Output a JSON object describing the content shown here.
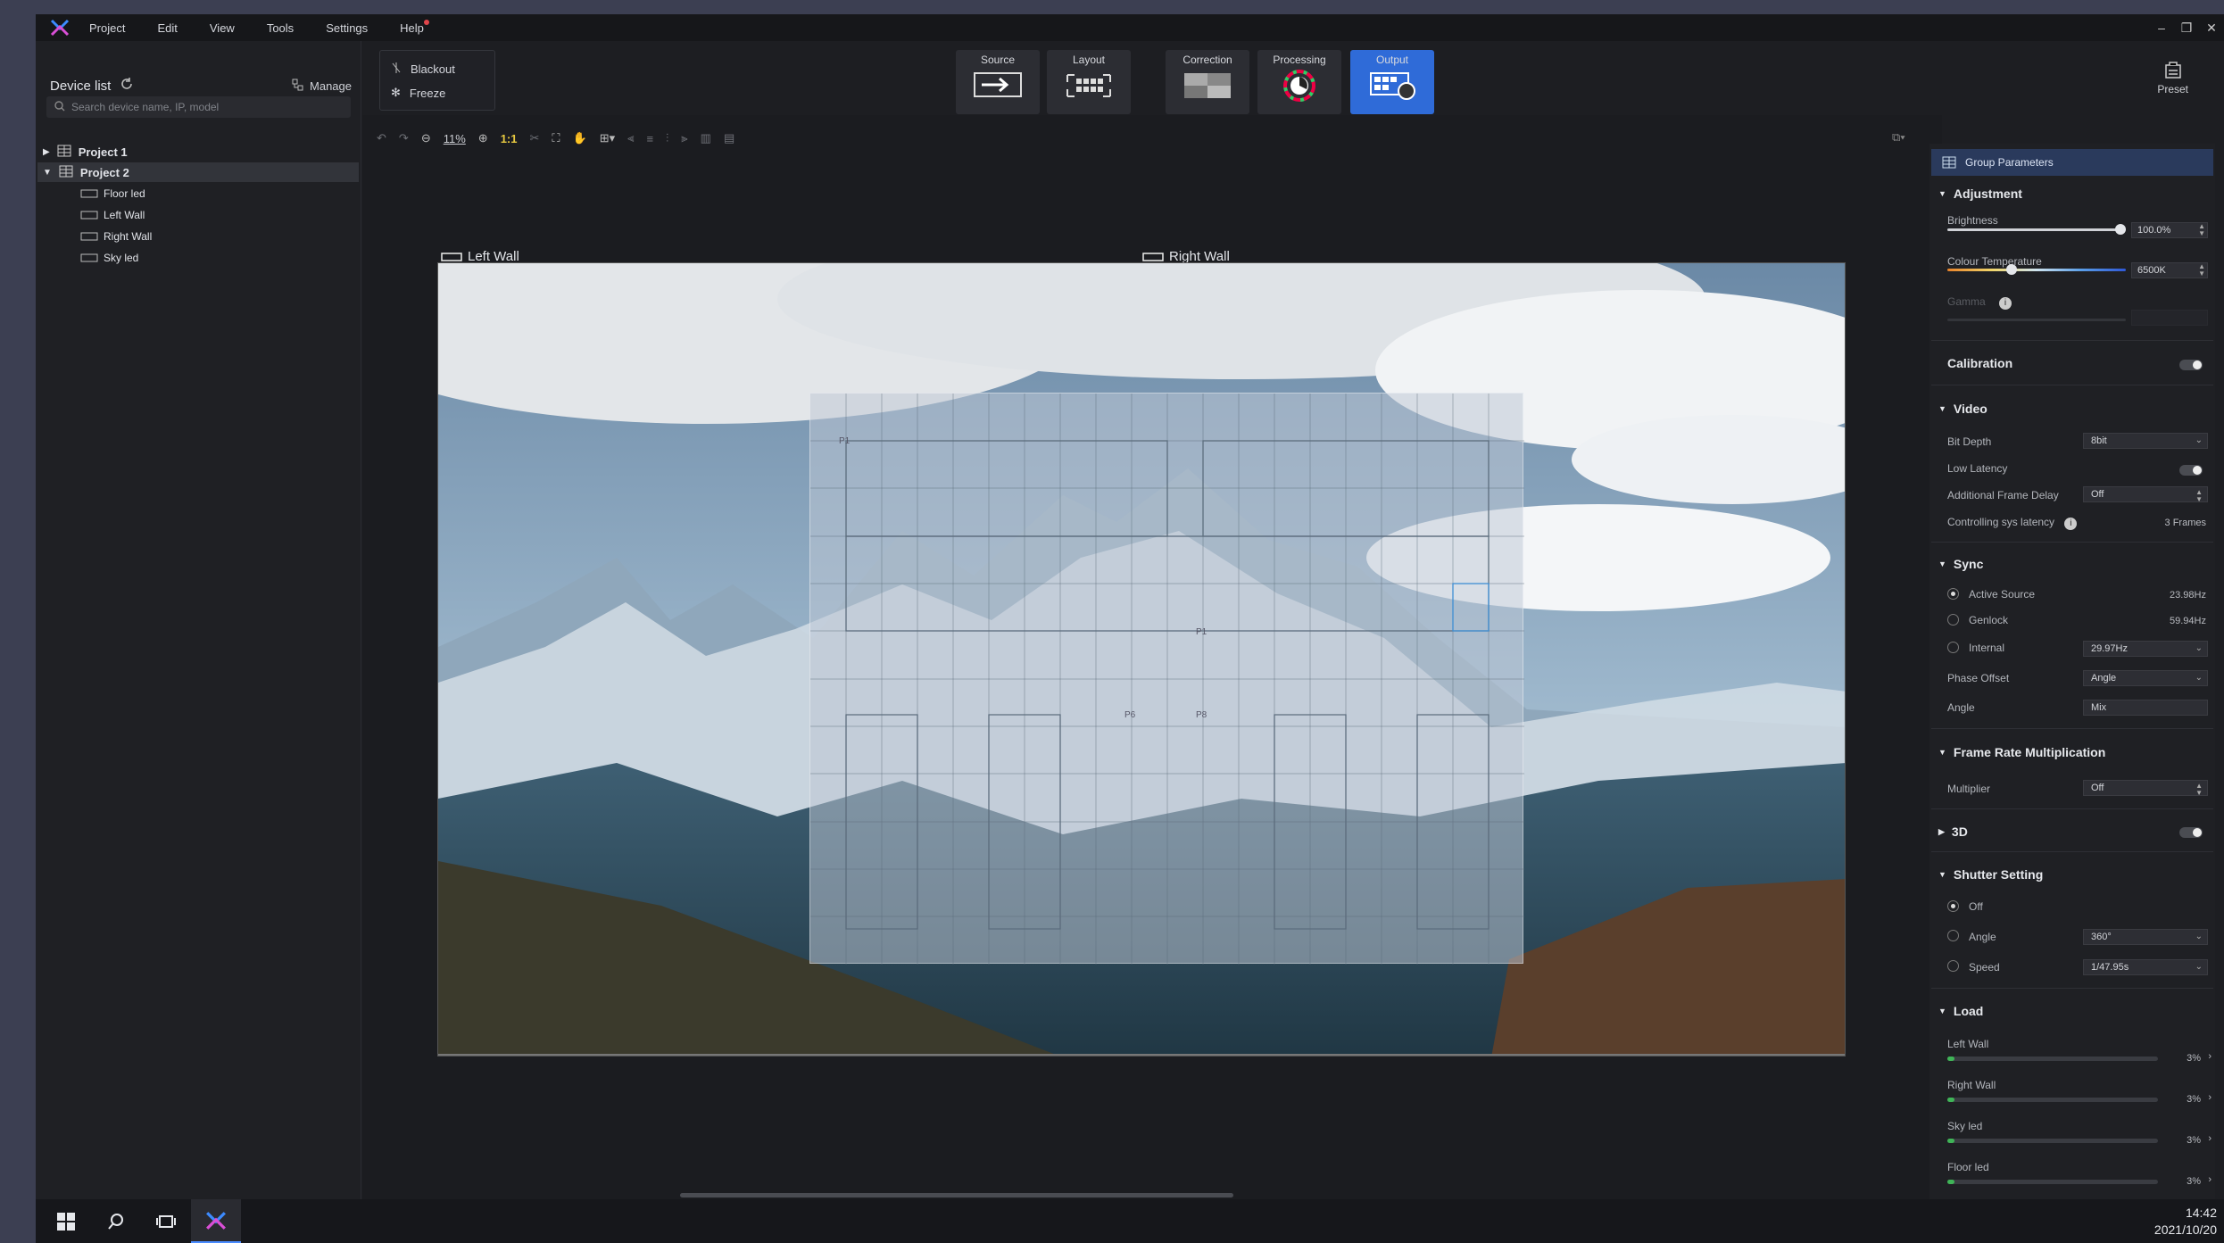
{
  "menu": [
    "Project",
    "Edit",
    "View",
    "Tools",
    "Settings",
    "Help"
  ],
  "device_list": {
    "title": "Device list",
    "manage": "Manage",
    "search_placeholder": "Search device name, IP, model",
    "projects": [
      {
        "label": "Project 1"
      },
      {
        "label": "Project 2"
      }
    ],
    "children": [
      "Floor led",
      "Left Wall",
      "Right Wall",
      "Sky led"
    ]
  },
  "quick": {
    "blackout": "Blackout",
    "freeze": "Freeze"
  },
  "modes": [
    {
      "label": "Source"
    },
    {
      "label": "Layout"
    },
    {
      "label": "Correction"
    },
    {
      "label": "Processing"
    },
    {
      "label": "Output"
    }
  ],
  "preset": "Preset",
  "toolbar": {
    "zoom": "11%",
    "one_to_one": "1:1"
  },
  "canvas": {
    "left_wall": "Left Wall",
    "right_wall": "Right Wall",
    "p1a": "P1",
    "p1b": "P1",
    "p6": "P6",
    "p8": "P8"
  },
  "panel": {
    "group_params": "Group Parameters",
    "adjustment": "Adjustment",
    "brightness": "Brightness",
    "brightness_val": "100.0%",
    "brightness_level": 1.0,
    "colour_temp": "Colour Temperature",
    "colour_temp_val": "6500K",
    "gamma": "Gamma",
    "calibration": "Calibration",
    "video": "Video",
    "bit_depth": "Bit Depth",
    "bit_depth_val": "8bit",
    "low_latency": "Low Latency",
    "frame_delay": "Additional Frame Delay",
    "frame_delay_val": "Off",
    "sys_latency": "Controlling sys latency",
    "sys_latency_val": "3 Frames",
    "sync": "Sync",
    "active_source": "Active Source",
    "active_source_val": "23.98Hz",
    "genlock": "Genlock",
    "genlock_val": "59.94Hz",
    "internal": "Internal",
    "internal_val": "29.97Hz",
    "phase_offset": "Phase Offset",
    "phase_offset_val": "Angle",
    "angle": "Angle",
    "angle_val": "Mix",
    "frm": "Frame Rate Multiplication",
    "multiplier": "Multiplier",
    "multiplier_val": "Off",
    "three_d": "3D",
    "shutter": "Shutter Setting",
    "sh_off": "Off",
    "sh_angle": "Angle",
    "sh_angle_val": "360°",
    "sh_speed": "Speed",
    "sh_speed_val": "1/47.95s",
    "load": "Load",
    "loads": [
      {
        "name": "Left Wall",
        "pct": "3%",
        "level": 0.03
      },
      {
        "name": "Right Wall",
        "pct": "3%",
        "level": 0.03
      },
      {
        "name": "Sky led",
        "pct": "3%",
        "level": 0.03
      },
      {
        "name": "Floor led",
        "pct": "3%",
        "level": 0.03
      }
    ]
  },
  "clock": {
    "time": "14:42",
    "date": "2021/10/20"
  },
  "colors": {
    "accent": "#2f6bd8",
    "active_load": "#3fb457"
  }
}
